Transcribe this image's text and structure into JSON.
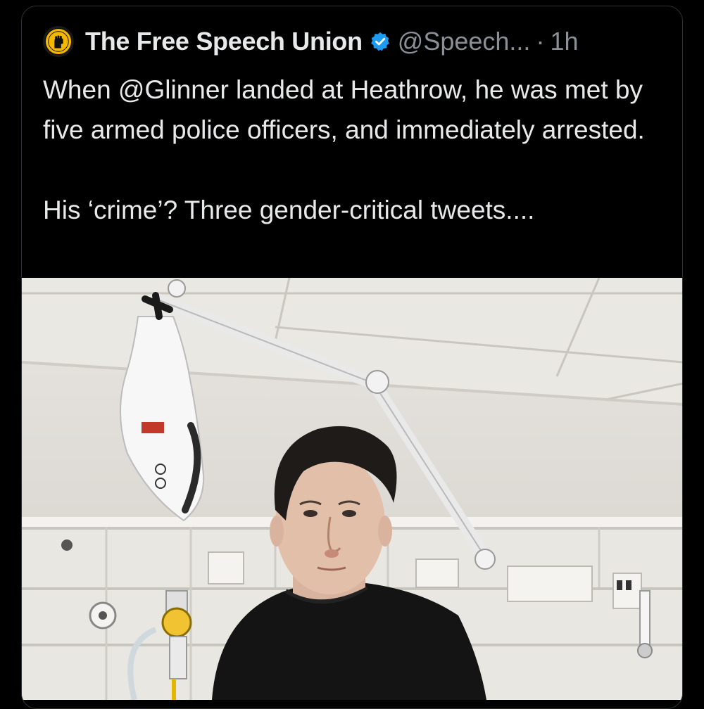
{
  "tweet": {
    "author_name": "The Free Speech Union",
    "handle": "@Speech...",
    "separator": "·",
    "time": "1h",
    "text": "When @Glinner landed at Heathrow, he was met by five armed police officers, and immediately arrested.\n\nHis ‘crime’? Three gender-critical tweets....",
    "avatar_icon": "raised-fist-icon",
    "verified_icon": "verified-badge-icon"
  },
  "colors": {
    "background": "#000000",
    "text": "#e7e9ea",
    "secondary_text": "#8b9096",
    "verified_blue": "#1d9bf0",
    "avatar_yellow": "#f5b800"
  }
}
